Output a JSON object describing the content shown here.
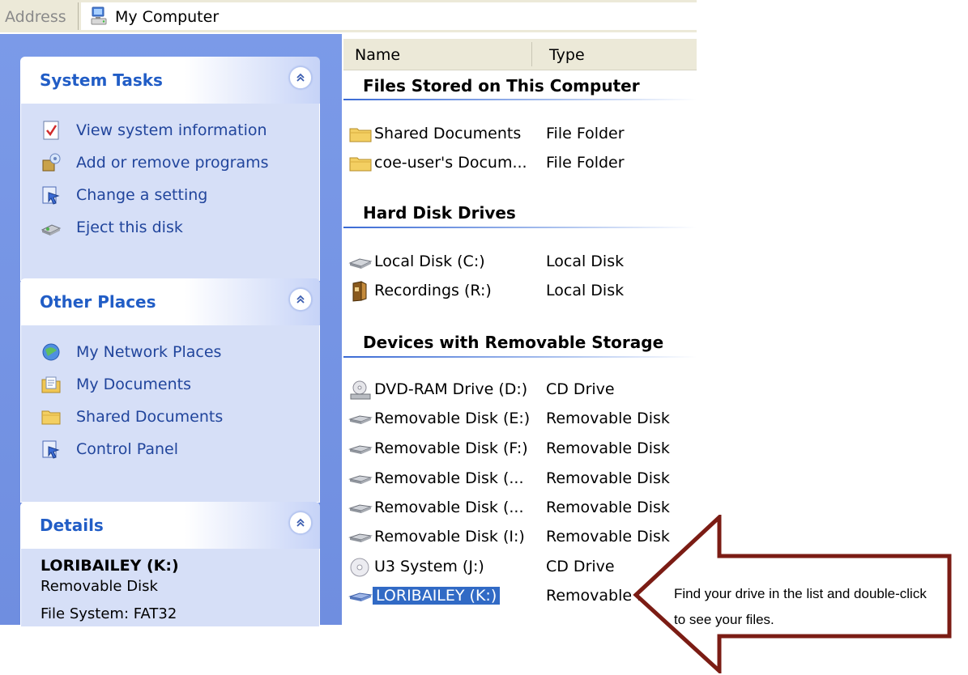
{
  "address": {
    "label": "Address",
    "value": "My Computer"
  },
  "columns": {
    "name": "Name",
    "type": "Type"
  },
  "task_pane": {
    "system_tasks": {
      "title": "System Tasks",
      "items": [
        {
          "label": "View system information",
          "icon": "system-info-icon"
        },
        {
          "label": "Add or remove programs",
          "icon": "add-remove-programs-icon"
        },
        {
          "label": "Change a setting",
          "icon": "control-panel-icon"
        },
        {
          "label": "Eject this disk",
          "icon": "eject-disk-icon"
        }
      ]
    },
    "other_places": {
      "title": "Other Places",
      "items": [
        {
          "label": "My Network Places",
          "icon": "network-places-icon"
        },
        {
          "label": "My Documents",
          "icon": "my-documents-icon"
        },
        {
          "label": "Shared Documents",
          "icon": "folder-icon"
        },
        {
          "label": "Control Panel",
          "icon": "control-panel-icon"
        }
      ]
    },
    "details": {
      "title": "Details",
      "name": "LORIBAILEY (K:)",
      "type": "Removable Disk",
      "file_system": "File System: FAT32"
    }
  },
  "groups": [
    {
      "title": "Files Stored on This Computer",
      "items": [
        {
          "name": "Shared Documents",
          "type": "File Folder",
          "icon": "folder-icon"
        },
        {
          "name": "coe-user's Docum...",
          "type": "File Folder",
          "icon": "folder-icon"
        }
      ]
    },
    {
      "title": "Hard Disk Drives",
      "items": [
        {
          "name": "Local Disk (C:)",
          "type": "Local Disk",
          "icon": "hard-disk-icon"
        },
        {
          "name": "Recordings (R:)",
          "type": "Local Disk",
          "icon": "recordings-drive-icon"
        }
      ]
    },
    {
      "title": "Devices with Removable Storage",
      "items": [
        {
          "name": "DVD-RAM Drive (D:)",
          "type": "CD Drive",
          "icon": "dvd-drive-icon"
        },
        {
          "name": "Removable Disk (E:)",
          "type": "Removable Disk",
          "icon": "removable-disk-icon"
        },
        {
          "name": "Removable Disk (F:)",
          "type": "Removable Disk",
          "icon": "removable-disk-icon"
        },
        {
          "name": "Removable Disk (...",
          "type": "Removable Disk",
          "icon": "removable-disk-icon"
        },
        {
          "name": "Removable Disk (...",
          "type": "Removable Disk",
          "icon": "removable-disk-icon"
        },
        {
          "name": "Removable Disk (I:)",
          "type": "Removable Disk",
          "icon": "removable-disk-icon"
        },
        {
          "name": "U3 System (J:)",
          "type": "CD Drive",
          "icon": "cd-icon"
        },
        {
          "name": "LORIBAILEY (K:)",
          "type": "Removable Disk",
          "icon": "removable-disk-icon",
          "selected": true
        }
      ]
    }
  ],
  "callout": {
    "text": "Find your drive in the list and double-click to see your files."
  },
  "colors": {
    "selection": "#316ac5",
    "pane": "#7b9ae8",
    "panel_title": "#215dc6",
    "callout_border": "#7b1c14"
  }
}
